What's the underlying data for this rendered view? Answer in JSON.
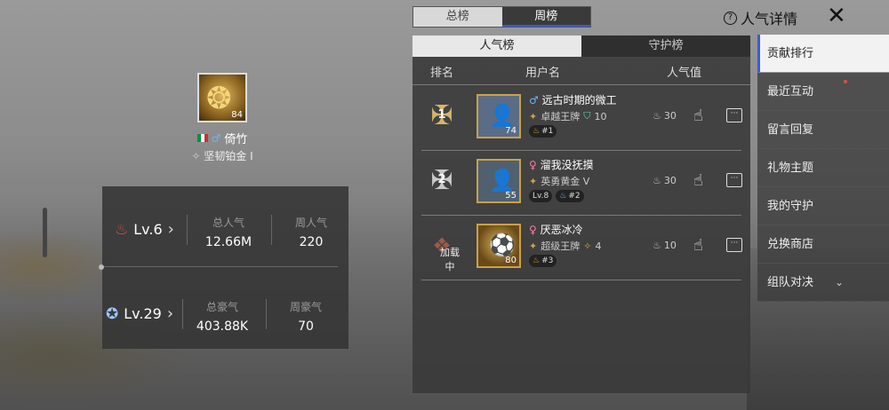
{
  "tabs": {
    "total": "总榜",
    "weekly": "周榜"
  },
  "subtabs": {
    "popularity": "人气榜",
    "guardian": "守护榜"
  },
  "columns": {
    "rank": "排名",
    "username": "用户名",
    "popularity": "人气值"
  },
  "title": "人气详情",
  "player": {
    "avatar_level": "84",
    "name": "倚竹",
    "rank": "坚韧铂金 I"
  },
  "stats": {
    "row1": {
      "level": "Lv.6",
      "total_label": "总人气",
      "total_value": "12.66M",
      "weekly_label": "周人气",
      "weekly_value": "220"
    },
    "row2": {
      "level": "Lv.29",
      "total_label": "总豪气",
      "total_value": "403.88K",
      "weekly_label": "周豪气",
      "weekly_value": "70"
    }
  },
  "rows": [
    {
      "rank": "1",
      "avatar_level": "74",
      "gender": "♂",
      "name": "远古时期的微工",
      "tier": "卓越王牌",
      "tier_extra": "10",
      "chips": [
        "#1"
      ],
      "popularity": "30"
    },
    {
      "rank": "2",
      "avatar_level": "55",
      "gender": "♀",
      "name": "溜我没抚摸",
      "tier": "英勇黄金 V",
      "tier_extra": "",
      "chips": [
        "Lv.8",
        "#2"
      ],
      "popularity": "30"
    },
    {
      "rank": "3",
      "loading": "加载中",
      "avatar_level": "80",
      "gender": "♀",
      "name": "厌恶冰冷",
      "tier": "超级王牌",
      "tier_extra": "4",
      "chips": [
        "#3"
      ],
      "popularity": "10"
    }
  ],
  "menu": {
    "items": [
      {
        "label": "贡献排行"
      },
      {
        "label": "最近互动"
      },
      {
        "label": "留言回复"
      },
      {
        "label": "礼物主题"
      },
      {
        "label": "我的守护"
      },
      {
        "label": "兑换商店"
      },
      {
        "label": "组队对决"
      }
    ]
  },
  "icons": {
    "close": "close-icon",
    "help": "help-icon",
    "fire": "fire-icon",
    "star": "star-badge-icon",
    "hand": "gift-hand-icon",
    "more": "more-icon"
  },
  "colors": {
    "accent": "#3a5adf",
    "fire": "#e04848"
  }
}
